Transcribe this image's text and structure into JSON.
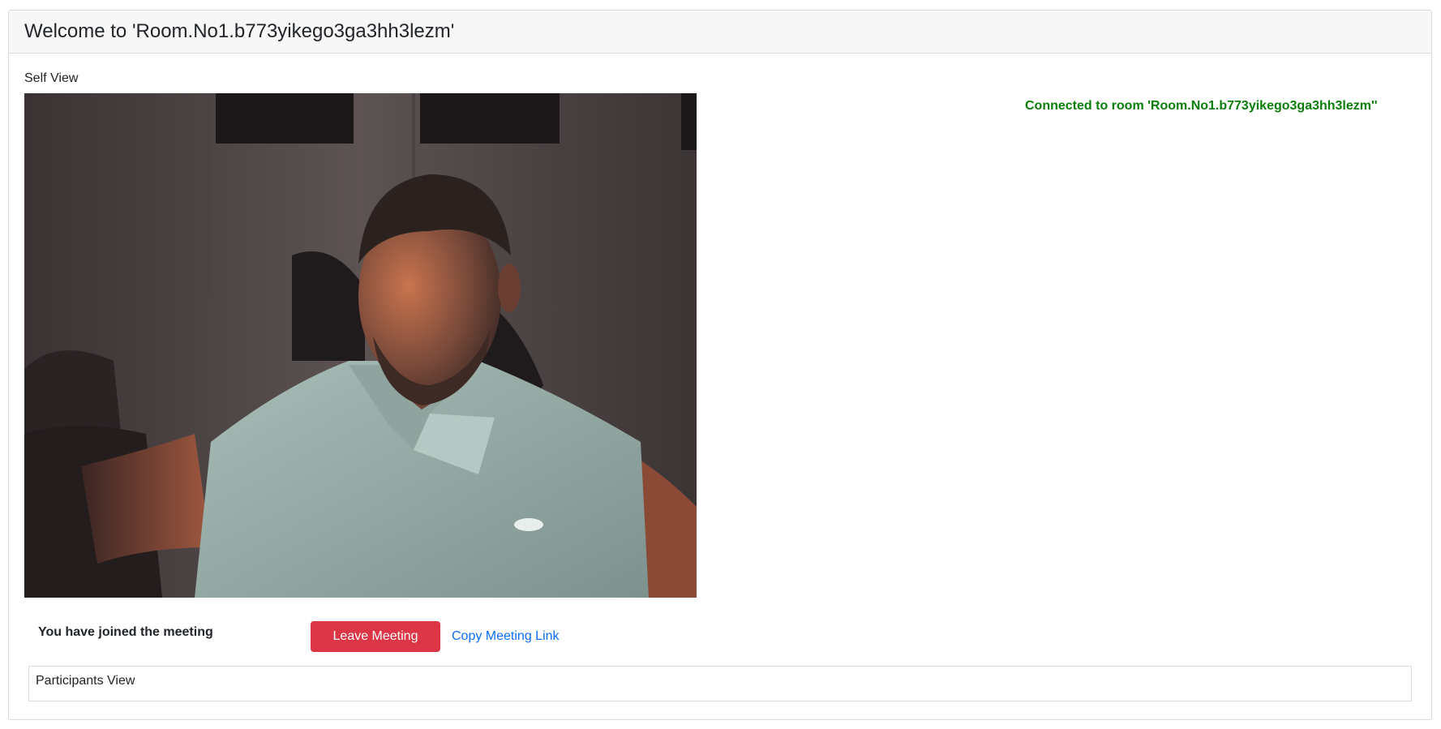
{
  "header": {
    "title": "Welcome to 'Room.No1.b773yikego3ga3hh3lezm'"
  },
  "self_view": {
    "label": "Self View"
  },
  "status": {
    "connected": "Connected to room 'Room.No1.b773yikego3ga3hh3lezm''",
    "connected_color": "#0a7d0a",
    "joined": "You have joined the meeting"
  },
  "actions": {
    "leave_label": "Leave Meeting",
    "leave_color": "#dc3545",
    "copy_link_label": "Copy Meeting Link",
    "link_color": "#0d6efd"
  },
  "participants": {
    "label": "Participants View"
  }
}
